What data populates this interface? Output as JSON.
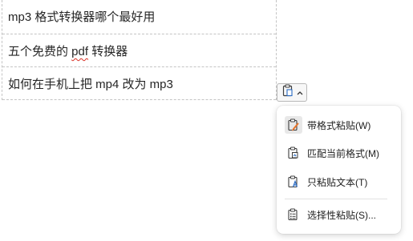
{
  "cells": [
    {
      "text_before": "mp3 格式转换器哪个最好用",
      "squiggle": "",
      "text_after": ""
    },
    {
      "text_before": "五个免费的 ",
      "squiggle": "pdf",
      "text_after": " 转换器"
    },
    {
      "text_before": "如何在手机上把 mp4 改为 mp3",
      "squiggle": "",
      "text_after": ""
    }
  ],
  "paste_menu": {
    "button_icon": "clipboard-icon",
    "items": [
      {
        "label": "带格式粘贴(W)",
        "icon": "clipboard-brush-icon"
      },
      {
        "label": "匹配当前格式(M)",
        "icon": "clipboard-match-icon"
      },
      {
        "label": "只粘贴文本(T)",
        "icon": "clipboard-text-icon"
      },
      {
        "label": "选择性粘贴(S)...",
        "icon": "clipboard-list-icon"
      }
    ]
  },
  "colors": {
    "accent_orange": "#e8742a",
    "accent_blue": "#2b6cc4",
    "spell_error": "#d93025"
  }
}
